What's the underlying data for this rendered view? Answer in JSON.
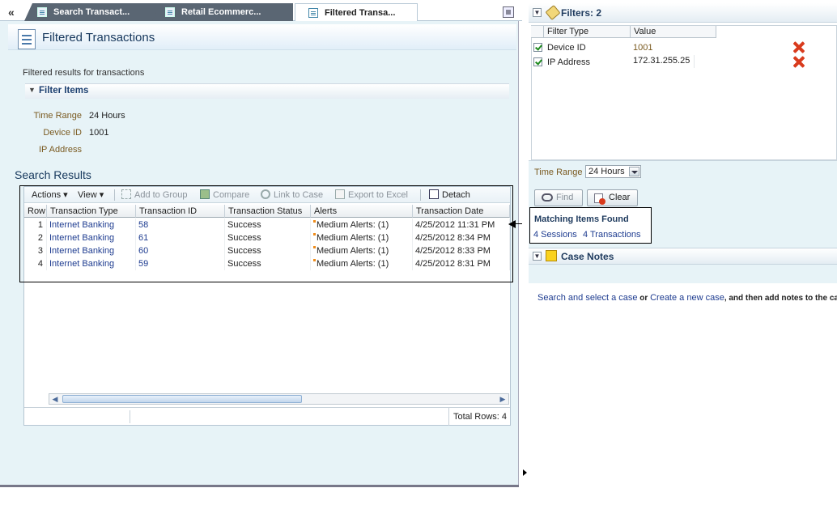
{
  "tabs": [
    {
      "label": "Search Transact..."
    },
    {
      "label": "Retail Ecommerc..."
    },
    {
      "label": "Filtered Transa..."
    }
  ],
  "nav_icon": "«",
  "page_title": "Filtered Transactions",
  "subtitle": "Filtered results for transactions",
  "filter_items": {
    "header": "Filter Items",
    "rows": [
      {
        "label": "Time Range",
        "value": "24 Hours"
      },
      {
        "label": "Device ID",
        "value": "1001"
      },
      {
        "label": "IP Address",
        "value": ""
      }
    ]
  },
  "search_results": {
    "title": "Search Results",
    "toolbar": {
      "actions": "Actions",
      "view": "View",
      "add_to_group": "Add to Group",
      "compare": "Compare",
      "link_to_case": "Link to Case",
      "export_to_excel": "Export to Excel",
      "detach": "Detach"
    },
    "columns": [
      "Row",
      "Transaction Type",
      "Transaction ID",
      "Transaction Status",
      "Alerts",
      "Transaction Date"
    ],
    "rows": [
      {
        "row": "1",
        "type": "Internet Banking",
        "id": "58",
        "status": "Success",
        "alerts": "Medium Alerts: (1)",
        "date": "4/25/2012 11:31 PM"
      },
      {
        "row": "2",
        "type": "Internet Banking",
        "id": "61",
        "status": "Success",
        "alerts": "Medium Alerts: (1)",
        "date": "4/25/2012 8:34 PM"
      },
      {
        "row": "3",
        "type": "Internet Banking",
        "id": "60",
        "status": "Success",
        "alerts": "Medium Alerts: (1)",
        "date": "4/25/2012 8:33 PM"
      },
      {
        "row": "4",
        "type": "Internet Banking",
        "id": "59",
        "status": "Success",
        "alerts": "Medium Alerts: (1)",
        "date": "4/25/2012 8:31 PM"
      }
    ],
    "total_rows": "Total Rows: 4"
  },
  "filters_panel": {
    "title": "Filters: 2",
    "columns": [
      "Filter Type",
      "Value"
    ],
    "rows": [
      {
        "type": "Device ID",
        "value": "1001"
      },
      {
        "type": "IP Address",
        "value": "172.31.255.25"
      }
    ],
    "time_range_label": "Time Range",
    "time_range_value": "24 Hours",
    "find_label": "Find",
    "clear_label": "Clear"
  },
  "matching": {
    "title": "Matching Items Found",
    "sessions": "4 Sessions",
    "transactions": "4 Transactions"
  },
  "case_notes": {
    "title": "Case Notes",
    "link1": "Search and select a case",
    "or": " or ",
    "link2": "Create a new case",
    "rest": ", and then add notes to the ca"
  },
  "colors": {
    "accent_title": "#16375c",
    "link": "#1e3c90",
    "alert_marker": "#ef8c1c",
    "pane_bg": "#e7f3f7",
    "delete_x": "#d93b1d"
  }
}
